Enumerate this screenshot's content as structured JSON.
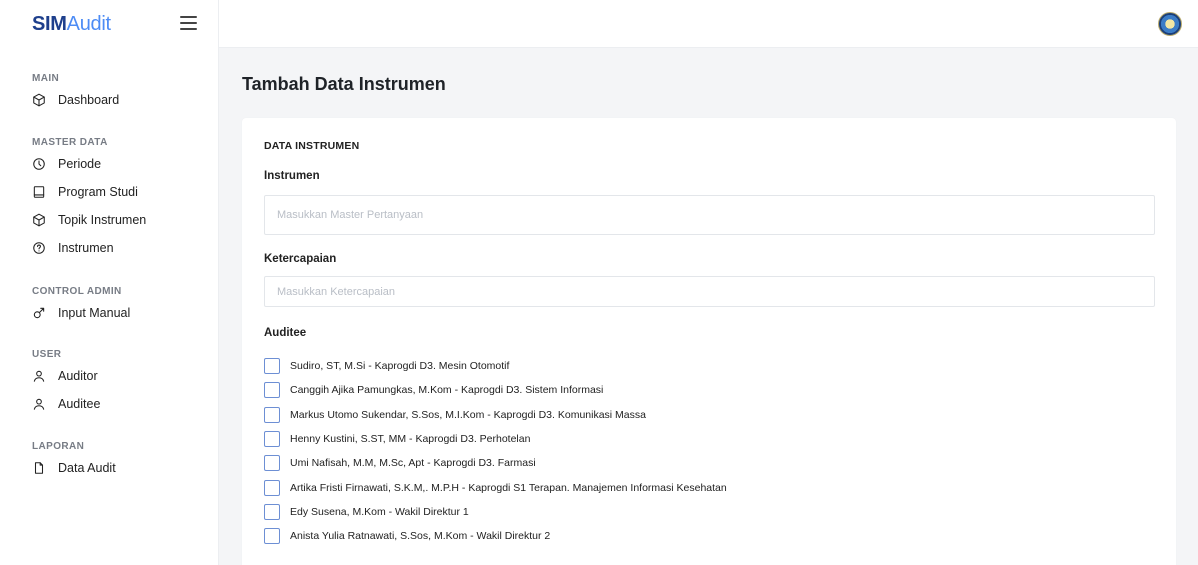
{
  "brand": {
    "bold": "SIM",
    "light": "Audit"
  },
  "sidebar": {
    "sections": [
      {
        "title": "MAIN",
        "items": [
          {
            "label": "Dashboard",
            "icon": "cube-icon"
          }
        ]
      },
      {
        "title": "MASTER DATA",
        "items": [
          {
            "label": "Periode",
            "icon": "clock-icon"
          },
          {
            "label": "Program Studi",
            "icon": "book-icon"
          },
          {
            "label": "Topik Instrumen",
            "icon": "cube-icon"
          },
          {
            "label": "Instrumen",
            "icon": "help-circle-icon"
          }
        ]
      },
      {
        "title": "CONTROL ADMIN",
        "items": [
          {
            "label": "Input Manual",
            "icon": "male-symbol-icon"
          }
        ]
      },
      {
        "title": "USER",
        "items": [
          {
            "label": "Auditor",
            "icon": "user-icon"
          },
          {
            "label": "Auditee",
            "icon": "user-icon"
          }
        ]
      },
      {
        "title": "LAPORAN",
        "items": [
          {
            "label": "Data Audit",
            "icon": "file-icon"
          }
        ]
      }
    ]
  },
  "page": {
    "title": "Tambah Data Instrumen"
  },
  "form": {
    "heading": "DATA INSTRUMEN",
    "instrumen_label": "Instrumen",
    "instrumen_placeholder": "Masukkan Master Pertanyaan",
    "instrumen_value": "",
    "ketercapaian_label": "Ketercapaian",
    "ketercapaian_placeholder": "Masukkan Ketercapaian",
    "ketercapaian_value": "",
    "auditee_label": "Auditee",
    "auditees": [
      "Sudiro, ST, M.Si - Kaprogdi D3. Mesin Otomotif",
      "Canggih Ajika Pamungkas, M.Kom - Kaprogdi D3. Sistem Informasi",
      "Markus Utomo Sukendar, S.Sos, M.I.Kom - Kaprogdi D3. Komunikasi Massa",
      "Henny Kustini, S.ST, MM - Kaprogdi D3. Perhotelan",
      "Umi Nafisah, M.M, M.Sc, Apt - Kaprogdi D3. Farmasi",
      "Artika Fristi Firnawati, S.K.M,. M.P.H - Kaprogdi S1 Terapan. Manajemen Informasi Kesehatan",
      "Edy Susena, M.Kom - Wakil Direktur 1",
      "Anista Yulia Ratnawati, S.Sos, M.Kom - Wakil Direktur 2"
    ]
  }
}
